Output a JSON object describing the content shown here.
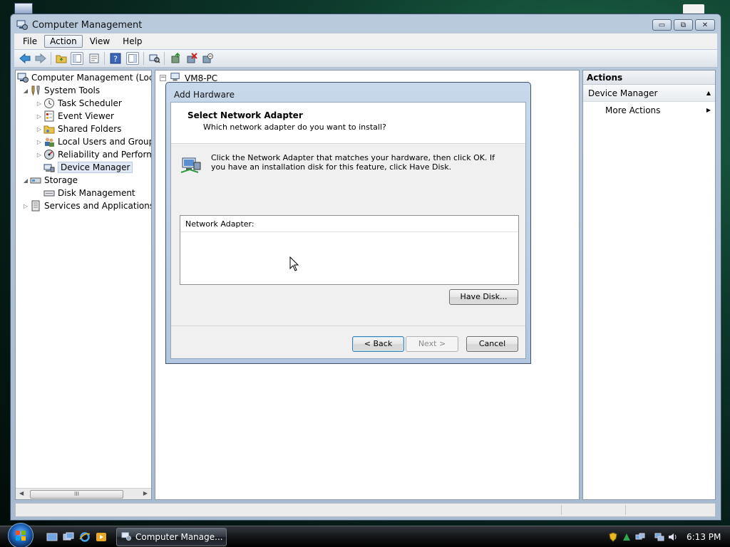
{
  "window": {
    "title": "Computer Management",
    "min_glyph": "▭",
    "max_glyph": "⧉",
    "close_glyph": "✕"
  },
  "menu": [
    "File",
    "Action",
    "View",
    "Help"
  ],
  "toolbar_icons": [
    "back-icon",
    "forward-icon",
    "up-folder-icon",
    "show-hide-tree-icon",
    "properties-icon",
    "help-icon",
    "show-hide-action-pane-icon",
    "scan-hardware-icon",
    "update-driver-icon",
    "uninstall-icon",
    "disable-icon"
  ],
  "tree": {
    "root": "Computer Management (Local",
    "system_tools": "System Tools",
    "task_scheduler": "Task Scheduler",
    "event_viewer": "Event Viewer",
    "shared_folders": "Shared Folders",
    "local_users": "Local Users and Groups",
    "reliability": "Reliability and Performa",
    "device_manager": "Device Manager",
    "storage": "Storage",
    "disk_management": "Disk Management",
    "services": "Services and Applications",
    "scroll_grip": "III"
  },
  "center": {
    "computer_name": "VM8-PC"
  },
  "actions": {
    "header": "Actions",
    "section": "Device Manager",
    "more_actions": "More Actions"
  },
  "dialog": {
    "title": "Add Hardware",
    "heading": "Select Network Adapter",
    "subheading": "Which network adapter do you want to install?",
    "instruction": "Click the Network Adapter that matches your hardware, then click OK. If you have an installation disk for this feature, click Have Disk.",
    "list_header": "Network Adapter:",
    "have_disk": "Have Disk...",
    "back": "< Back",
    "next": "Next >",
    "cancel": "Cancel"
  },
  "taskbar": {
    "task_label": "Computer Manage...",
    "clock": "6:13 PM"
  }
}
